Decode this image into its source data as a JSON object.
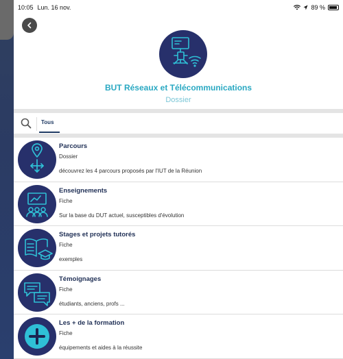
{
  "status_bar": {
    "time": "10:05",
    "date": "Lun. 16 nov.",
    "battery": "89 %"
  },
  "header": {
    "title": "BUT Réseaux et Télécommunications",
    "subtitle": "Dossier"
  },
  "toolbar": {
    "tab_label": "Tous"
  },
  "items": [
    {
      "title": "Parcours",
      "type": "Dossier",
      "description": "découvrez les 4 parcours proposés par l'IUT de la Réunion",
      "icon": "location-arrows-icon"
    },
    {
      "title": "Enseignements",
      "type": "Fiche",
      "description": "Sur la base du DUT actuel, susceptibles d'évolution",
      "icon": "classroom-icon"
    },
    {
      "title": "Stages et projets tutorés",
      "type": "Fiche",
      "description": "exemples",
      "icon": "book-graduation-icon"
    },
    {
      "title": "Témoignages",
      "type": "Fiche",
      "description": "étudiants, anciens, profs ...",
      "icon": "chat-bubbles-icon"
    },
    {
      "title": "Les + de la formation",
      "type": "Fiche",
      "description": "équipements et aides à la réussite",
      "icon": "plus-circle-icon"
    }
  ],
  "colors": {
    "accent": "#29a8c2",
    "icon_bg": "#27306b",
    "icon_line": "#2fc0d6",
    "title": "#1f2f55"
  }
}
